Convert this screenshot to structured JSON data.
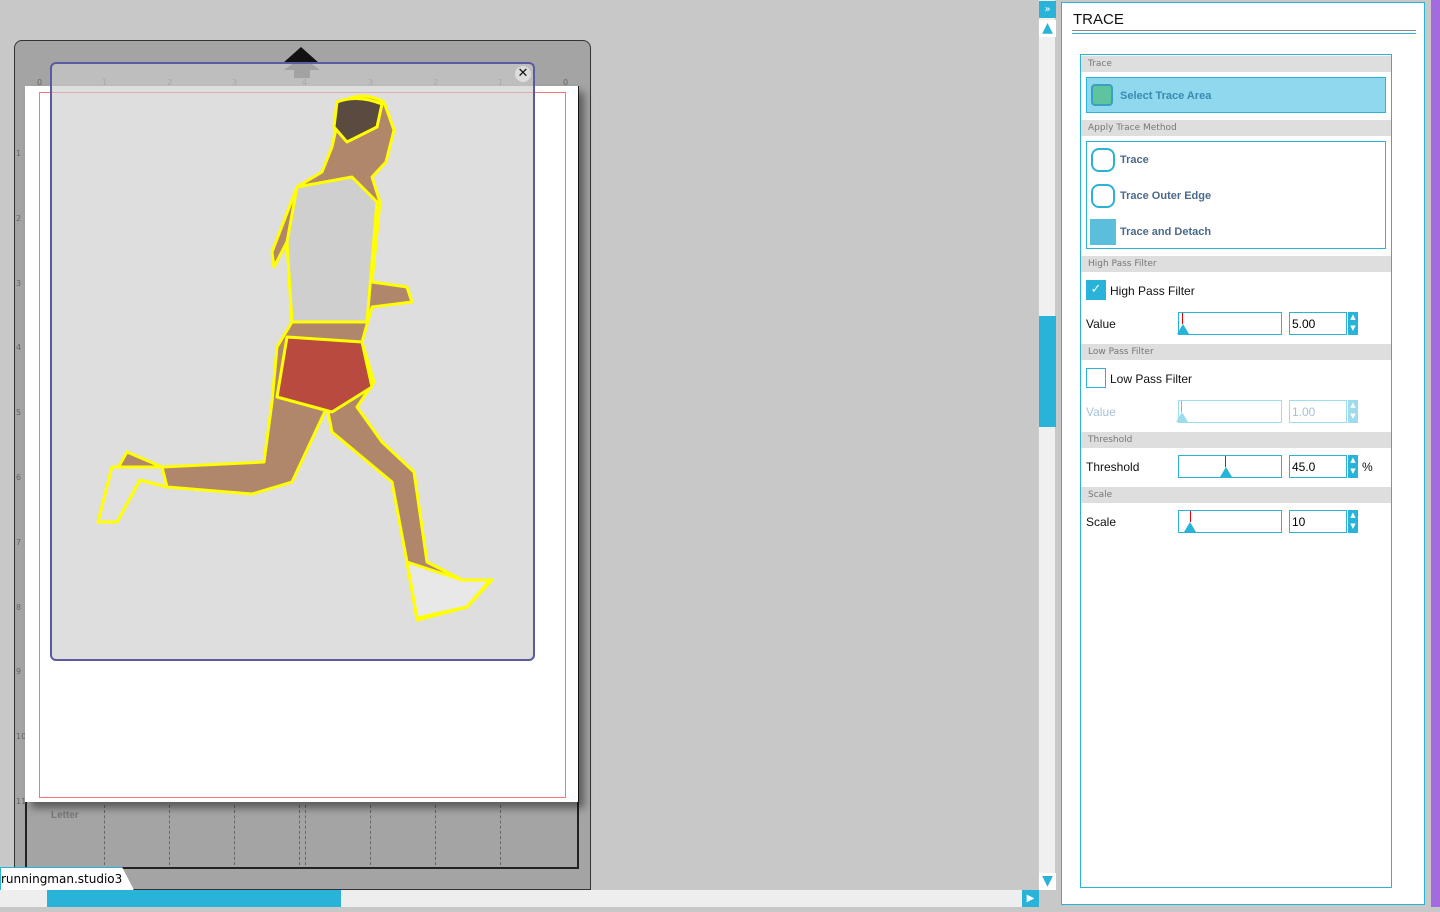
{
  "document": {
    "tab_name": "runningman.studio3",
    "media_label": "Letter",
    "top_ruler": [
      "0",
      "1",
      "2",
      "3",
      "4",
      "3",
      "2",
      "1",
      "0"
    ],
    "left_ruler": [
      "1",
      "2",
      "3",
      "4",
      "5",
      "6",
      "7",
      "8",
      "9",
      "10",
      "11"
    ]
  },
  "panel": {
    "title": "TRACE",
    "sections": {
      "trace": "Trace",
      "method": "Apply Trace Method",
      "high": "High Pass Filter",
      "low": "Low Pass Filter",
      "threshold": "Threshold",
      "scale": "Scale"
    },
    "select_trace_area": "Select Trace Area",
    "methods": [
      "Trace",
      "Trace Outer Edge",
      "Trace and Detach"
    ],
    "high_pass": {
      "label": "High Pass Filter",
      "checked": true,
      "value_label": "Value",
      "value": "5.00",
      "fraction": 0.03
    },
    "low_pass": {
      "label": "Low Pass Filter",
      "checked": false,
      "value_label": "Value",
      "value": "1.00",
      "fraction": 0.02
    },
    "threshold": {
      "label": "Threshold",
      "value": "45.0",
      "unit": "%",
      "fraction": 0.45
    },
    "scale": {
      "label": "Scale",
      "value": "10",
      "fraction": 0.1
    }
  },
  "colors": {
    "accent": "#29b3d9",
    "trace_outline": "#ffff00",
    "accent_strip": "#a46ae0"
  }
}
